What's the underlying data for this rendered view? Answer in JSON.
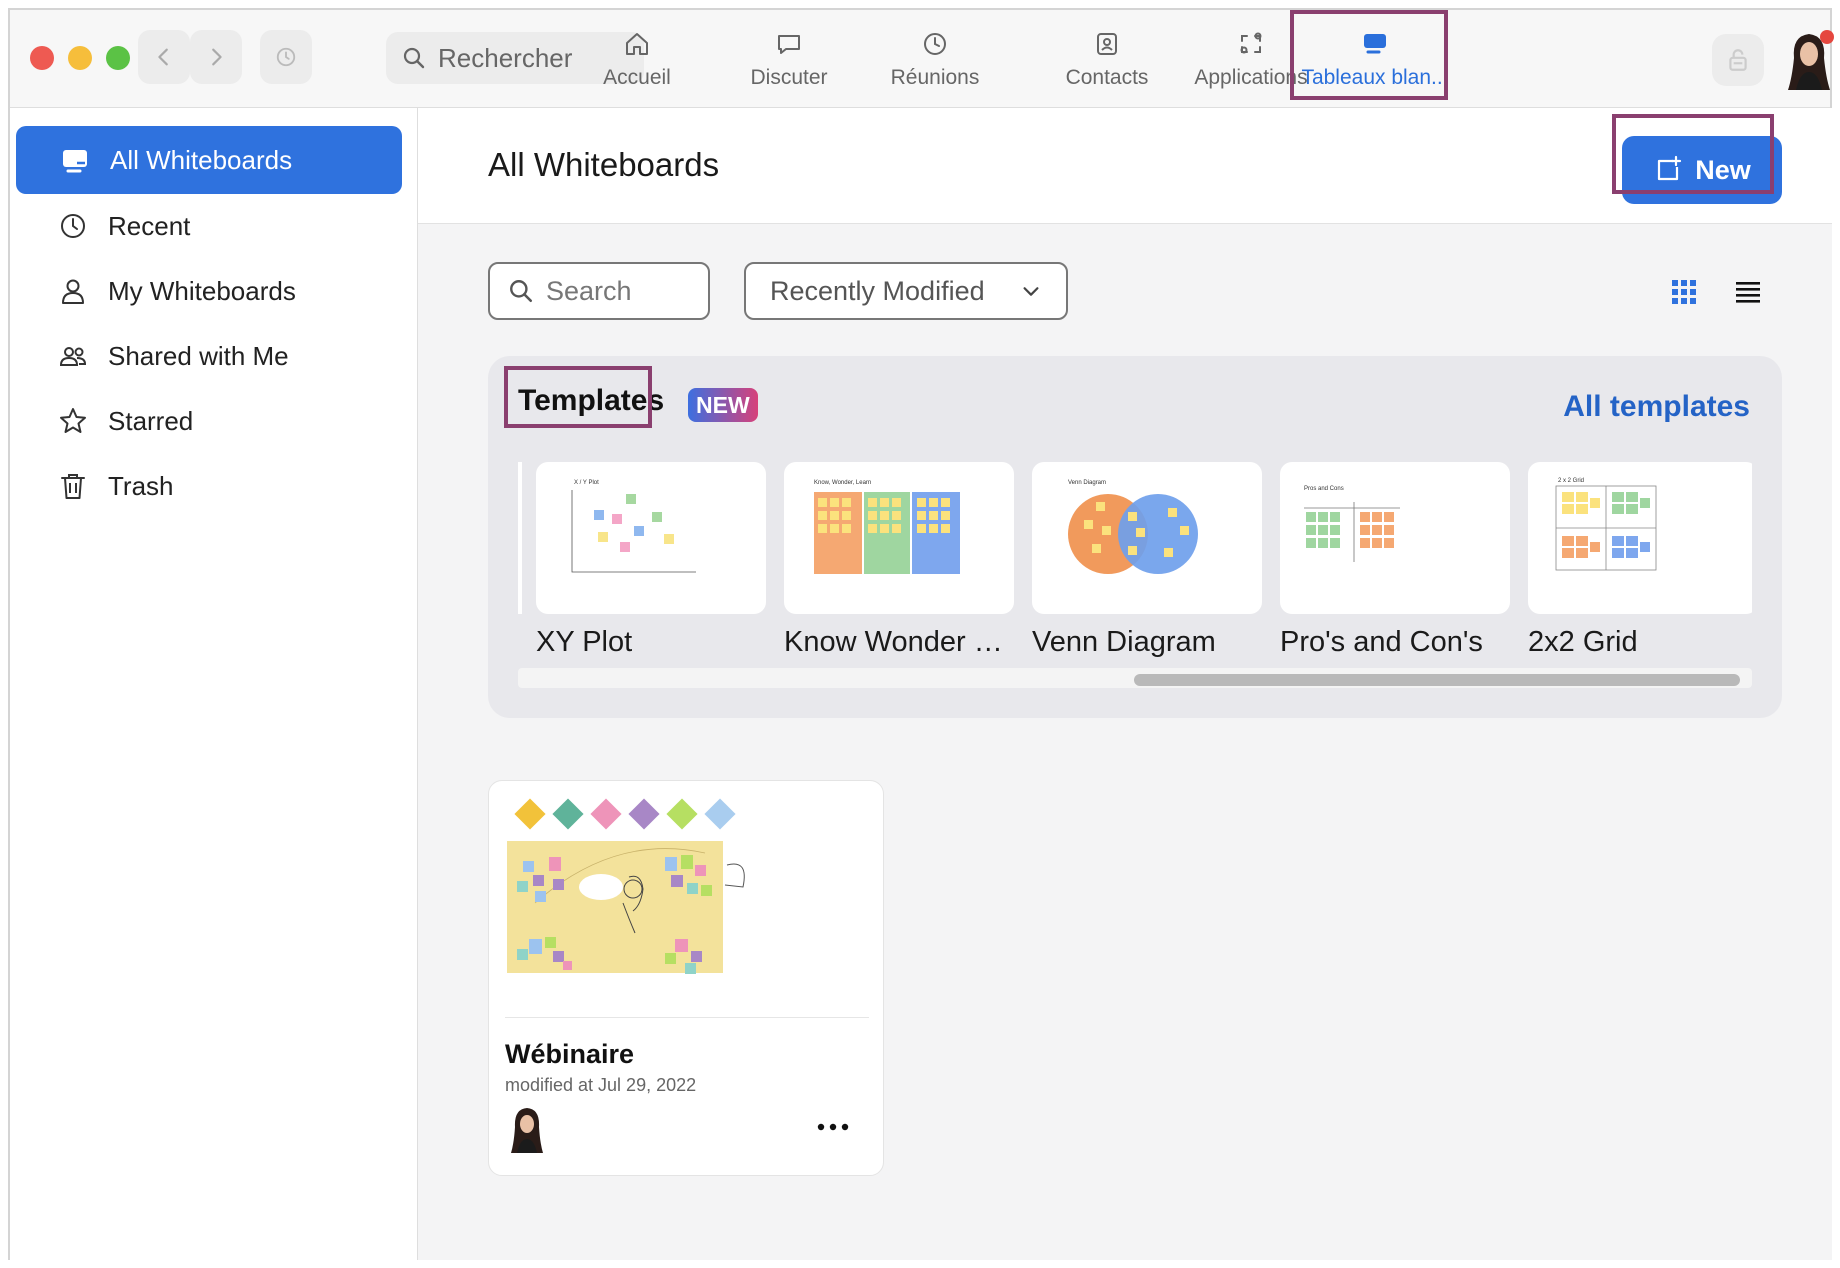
{
  "window": {
    "search_placeholder": "Rechercher"
  },
  "top_tabs": [
    {
      "label": "Accueil",
      "icon": "home-icon"
    },
    {
      "label": "Discuter",
      "icon": "chat-icon"
    },
    {
      "label": "Réunions",
      "icon": "clock-icon"
    },
    {
      "label": "Contacts",
      "icon": "contact-icon"
    },
    {
      "label": "Applications",
      "icon": "apps-icon"
    },
    {
      "label": "Tableaux blan...",
      "icon": "whiteboard-icon",
      "active": true
    }
  ],
  "sidebar": {
    "items": [
      {
        "label": "All Whiteboards",
        "icon": "whiteboard-icon",
        "active": true
      },
      {
        "label": "Recent",
        "icon": "clock-icon"
      },
      {
        "label": "My Whiteboards",
        "icon": "person-icon"
      },
      {
        "label": "Shared with Me",
        "icon": "people-icon"
      },
      {
        "label": "Starred",
        "icon": "star-icon"
      },
      {
        "label": "Trash",
        "icon": "trash-icon"
      }
    ]
  },
  "main": {
    "title": "All Whiteboards",
    "new_label": "New",
    "search_placeholder": "Search",
    "sort_value": "Recently Modified"
  },
  "templates": {
    "title": "Templates",
    "badge": "NEW",
    "all_link": "All templates",
    "items": [
      {
        "name": "XY Plot",
        "thumb_title": "X / Y Plot"
      },
      {
        "name": "Know Wonder Learn",
        "thumb_title": "Know, Wonder, Learn"
      },
      {
        "name": "Venn Diagram",
        "thumb_title": "Venn Diagram"
      },
      {
        "name": "Pro's and Con's",
        "thumb_title": "Pros and Cons"
      },
      {
        "name": "2x2 Grid",
        "thumb_title": "2 x 2 Grid"
      }
    ]
  },
  "whiteboards": [
    {
      "name": "Wébinaire",
      "modified": "modified at Jul 29, 2022"
    }
  ],
  "colors": {
    "accent": "#2f72de",
    "highlight": "#8a3f6f",
    "link": "#2463c6"
  }
}
